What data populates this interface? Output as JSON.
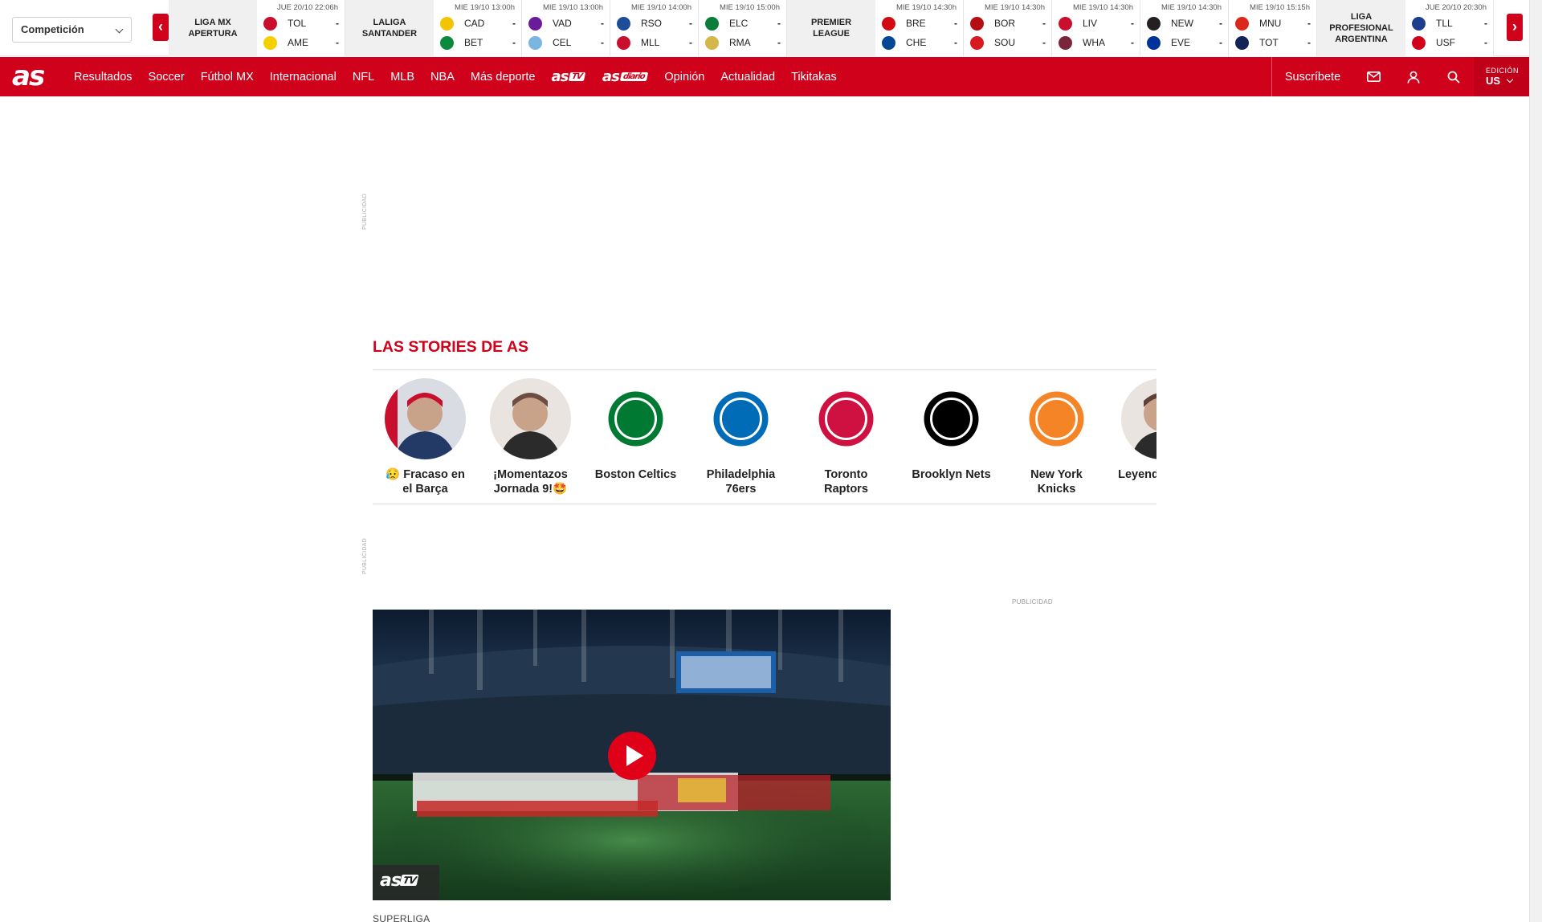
{
  "scorebar": {
    "competition_select": "Competición",
    "prev_label": "‹",
    "next_label": "›",
    "groups": [
      {
        "competition": "Liga MX Apertura",
        "matches": [
          {
            "time": "JUE 20/10 22:06h",
            "home": "TOL",
            "away": "AME",
            "home_score": "-",
            "away_score": "-",
            "home_color": "#c8102e",
            "away_color": "#f5d000"
          }
        ]
      },
      {
        "competition": "LaLiga Santander",
        "matches": [
          {
            "time": "MIE 19/10 13:00h",
            "home": "CAD",
            "away": "BET",
            "home_score": "-",
            "away_score": "-",
            "home_color": "#f2c500",
            "away_color": "#0b8a3e"
          },
          {
            "time": "MIE 19/10 13:00h",
            "home": "VAD",
            "away": "CEL",
            "home_score": "-",
            "away_score": "-",
            "home_color": "#6a1b9a",
            "away_color": "#7ab6e0"
          },
          {
            "time": "MIE 19/10 14:00h",
            "home": "RSO",
            "away": "MLL",
            "home_score": "-",
            "away_score": "-",
            "home_color": "#1e4e9a",
            "away_color": "#c8102e"
          },
          {
            "time": "MIE 19/10 15:00h",
            "home": "ELC",
            "away": "RMA",
            "home_score": "-",
            "away_score": "-",
            "home_color": "#0a7d3a",
            "away_color": "#d4b64a"
          }
        ]
      },
      {
        "competition": "Premier League",
        "matches": [
          {
            "time": "MIE 19/10 14:30h",
            "home": "BRE",
            "away": "CHE",
            "home_score": "-",
            "away_score": "-",
            "home_color": "#d20a11",
            "away_color": "#034694"
          },
          {
            "time": "MIE 19/10 14:30h",
            "home": "BOR",
            "away": "SOU",
            "home_score": "-",
            "away_score": "-",
            "home_color": "#b50e12",
            "away_color": "#d71920"
          },
          {
            "time": "MIE 19/10 14:30h",
            "home": "LIV",
            "away": "WHA",
            "home_score": "-",
            "away_score": "-",
            "home_color": "#c8102e",
            "away_color": "#7a263a"
          },
          {
            "time": "MIE 19/10 14:30h",
            "home": "NEW",
            "away": "EVE",
            "home_score": "-",
            "away_score": "-",
            "home_color": "#241f20",
            "away_color": "#003399"
          },
          {
            "time": "MIE 19/10 15:15h",
            "home": "MNU",
            "away": "TOT",
            "home_score": "-",
            "away_score": "-",
            "home_color": "#da291c",
            "away_color": "#132257"
          }
        ]
      },
      {
        "competition": "Liga Profesional Argentina",
        "matches": [
          {
            "time": "JUE 20/10 20:30h",
            "home": "TLL",
            "away": "USF",
            "home_score": "-",
            "away_score": "-",
            "home_color": "#1d3d8f",
            "away_color": "#d0021b"
          }
        ]
      }
    ]
  },
  "navbar": {
    "logo": "as",
    "links": [
      {
        "kind": "text",
        "label": "Resultados"
      },
      {
        "kind": "text",
        "label": "Soccer"
      },
      {
        "kind": "text",
        "label": "Fútbol MX"
      },
      {
        "kind": "text",
        "label": "Internacional"
      },
      {
        "kind": "text",
        "label": "NFL"
      },
      {
        "kind": "text",
        "label": "MLB"
      },
      {
        "kind": "text",
        "label": "NBA"
      },
      {
        "kind": "text",
        "label": "Más deporte"
      },
      {
        "kind": "brand",
        "label": "as",
        "tag": "TV"
      },
      {
        "kind": "brand",
        "label": "as",
        "tag": "diario"
      },
      {
        "kind": "text",
        "label": "Opinión"
      },
      {
        "kind": "text",
        "label": "Actualidad"
      },
      {
        "kind": "text",
        "label": "Tikitakas"
      }
    ],
    "subscribe": "Suscríbete",
    "edition_label": "EDICIÓN",
    "edition_value": "US",
    "icons": [
      "mail-icon",
      "user-icon",
      "search-icon"
    ]
  },
  "ads": {
    "label": "PUBLICIDAD"
  },
  "stories": {
    "title": "LAS STORIES DE AS",
    "items": [
      {
        "name": "😥 Fracaso en el Barça",
        "avatar": "person-photo",
        "color": "#c8102e"
      },
      {
        "name": "¡Momentazos Jornada 9!🤩",
        "avatar": "person-photo",
        "color": "#6d4c41"
      },
      {
        "name": "Boston Celtics",
        "avatar": "celtics-logo",
        "color": "#007a33"
      },
      {
        "name": "Philadelphia 76ers",
        "avatar": "76ers-logo",
        "color": "#006bb6"
      },
      {
        "name": "Toronto Raptors",
        "avatar": "raptors-logo",
        "color": "#ce1141"
      },
      {
        "name": "Brooklyn Nets",
        "avatar": "nets-logo",
        "color": "#000000"
      },
      {
        "name": "New York Knicks",
        "avatar": "knicks-logo",
        "color": "#f58426"
      },
      {
        "name": "Leyenda mate a L",
        "avatar": "person-photo",
        "color": "#5d4037"
      }
    ]
  },
  "video": {
    "badge_logo": "as",
    "badge_tag": "TV",
    "section": "SUPERLIGA"
  },
  "colors": {
    "brand_red": "#d0021b"
  }
}
